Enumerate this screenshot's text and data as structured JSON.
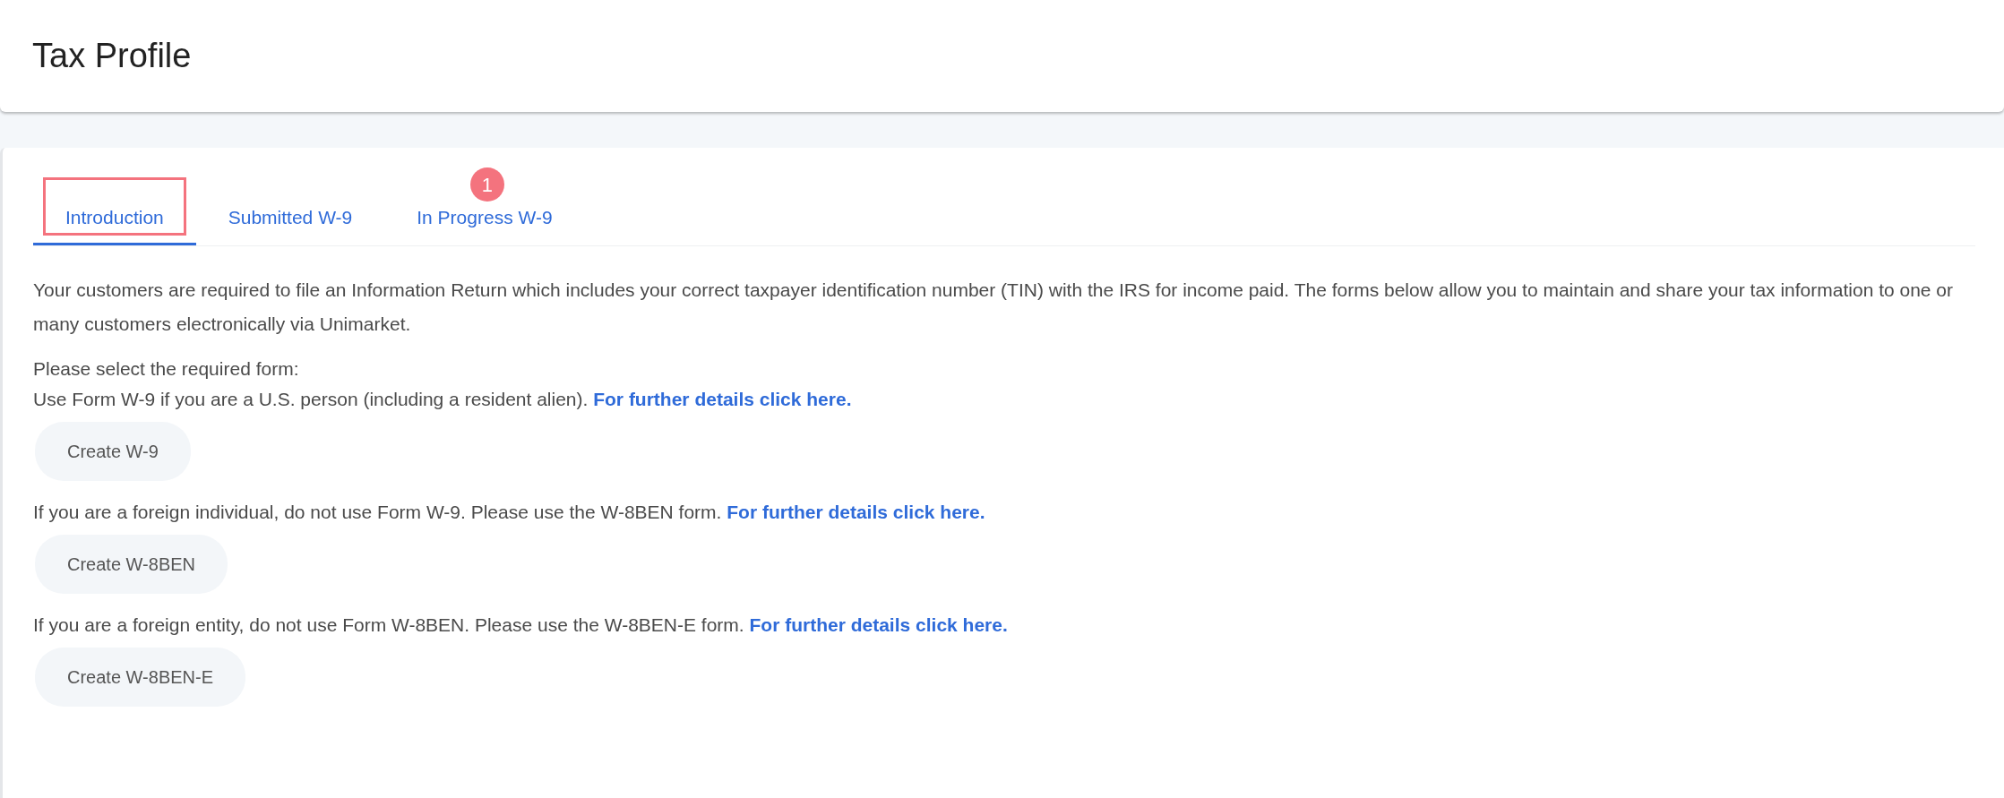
{
  "header": {
    "title": "Tax Profile"
  },
  "tabs": [
    {
      "label": "Introduction",
      "selected": true,
      "focused": true
    },
    {
      "label": "Submitted W-9",
      "selected": false,
      "focused": false
    },
    {
      "label": "In Progress W-9",
      "selected": false,
      "focused": false,
      "badge": "1"
    }
  ],
  "intro": "Your customers are required to file an Information Return which includes your correct taxpayer identification number (TIN) with the IRS for income paid. The forms below allow you to maintain and share your tax information to one or many customers electronically via Unimarket.",
  "prompt": "Please select the required form:",
  "options": [
    {
      "text": "Use Form W-9 if you are a U.S. person (including a resident alien).",
      "link": "For further details click here.",
      "button": "Create W-9"
    },
    {
      "text": "If you are a foreign individual, do not use Form W-9. Please use the W-8BEN form.",
      "link": "For further details click here.",
      "button": "Create W-8BEN"
    },
    {
      "text": "If you are a foreign entity, do not use Form W-8BEN. Please use the W-8BEN-E form.",
      "link": "For further details click here.",
      "button": "Create W-8BEN-E"
    }
  ]
}
